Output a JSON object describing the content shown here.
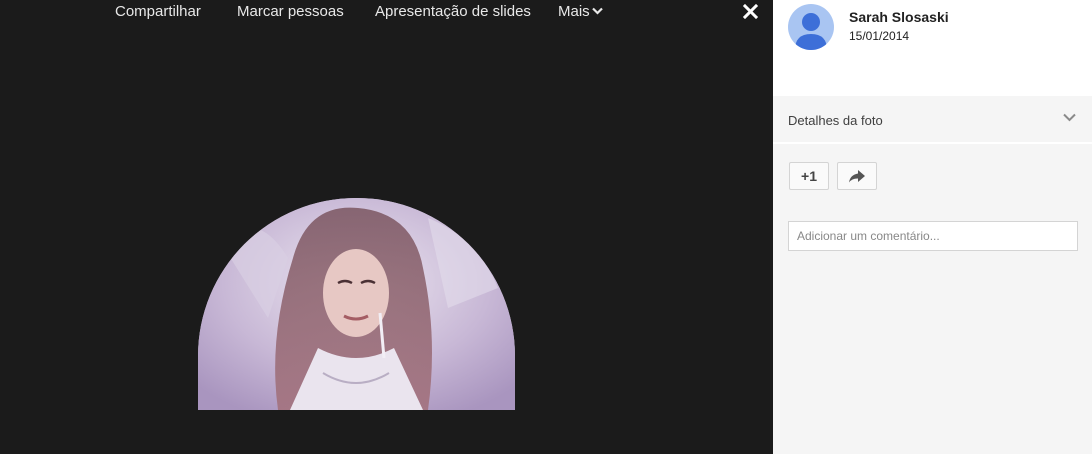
{
  "toolbar": {
    "share_label": "Compartilhar",
    "tag_label": "Marcar pessoas",
    "slideshow_label": "Apresentação de slides",
    "more_label": "Mais"
  },
  "post": {
    "author_name": "Sarah Slosaski",
    "date": "15/01/2014"
  },
  "details": {
    "label": "Detalhes da foto"
  },
  "actions": {
    "plus_one_label": "+1"
  },
  "comment": {
    "placeholder": "Adicionar um comentário..."
  },
  "colors": {
    "viewer_bg": "#1b1b1b",
    "panel_bg": "#f5f5f5",
    "avatar_bg": "#a9c5f2",
    "avatar_fg": "#3d6fd8",
    "photo_tint": "#cbbfd6"
  }
}
